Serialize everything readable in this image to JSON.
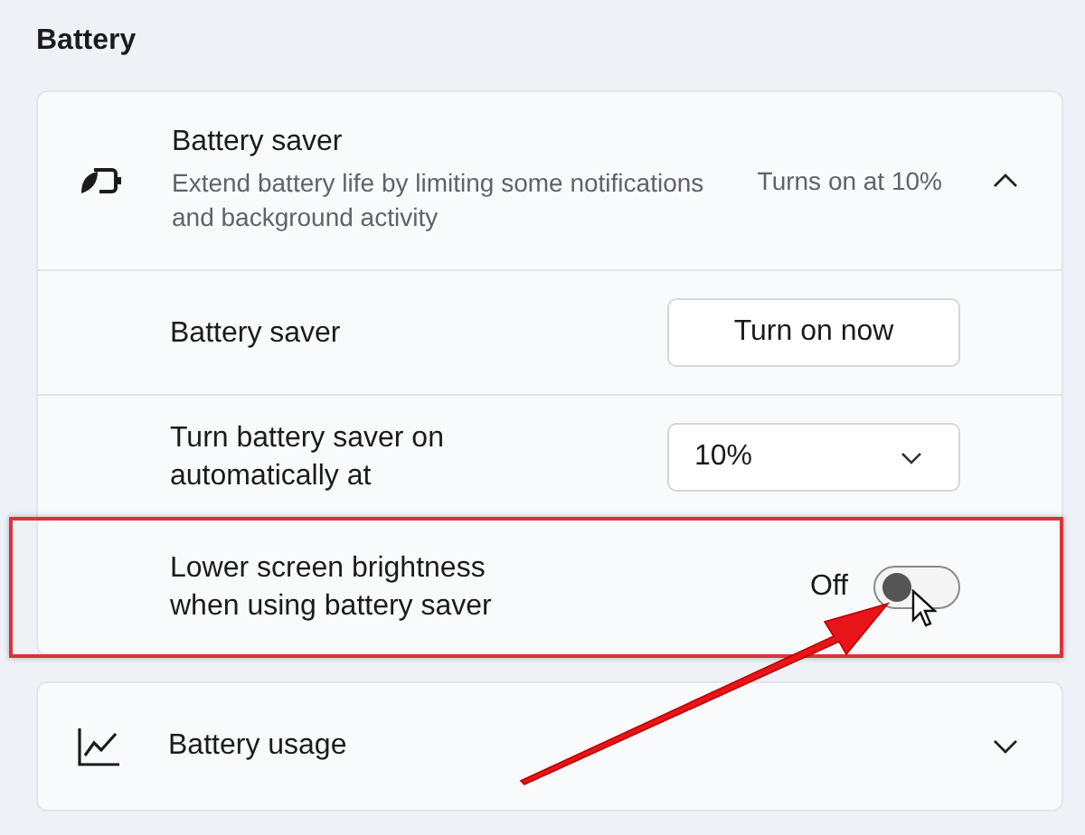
{
  "section_title": "Battery",
  "battery_saver": {
    "title": "Battery saver",
    "description": "Extend battery life by limiting some notifications and background activity",
    "status": "Turns on at 10%",
    "expanded": true,
    "settings": [
      {
        "kind": "button",
        "label": "Battery saver",
        "button": "Turn on now",
        "highlighted": false
      },
      {
        "kind": "dropdown",
        "label": "Turn battery saver on automatically at",
        "value": "10%",
        "highlighted": false
      },
      {
        "kind": "toggle",
        "label": "Lower screen brightness when using battery saver",
        "state_text": "Off",
        "on": false,
        "highlighted": true
      }
    ]
  },
  "battery_usage": {
    "title": "Battery usage",
    "expanded": false
  }
}
